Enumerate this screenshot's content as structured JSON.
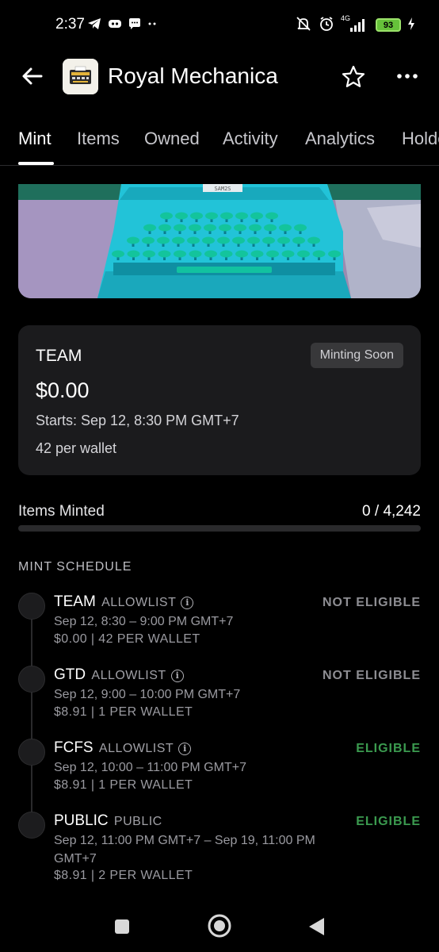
{
  "status_bar": {
    "time": "2:37",
    "network": "4G",
    "battery": "93"
  },
  "header": {
    "title": "Royal Mechanica"
  },
  "tabs": [
    {
      "label": "Mint",
      "active": true
    },
    {
      "label": "Items"
    },
    {
      "label": "Owned"
    },
    {
      "label": "Activity"
    },
    {
      "label": "Analytics"
    },
    {
      "label": "Holders"
    }
  ],
  "banner": {
    "sign_text": "SAM2S"
  },
  "current_phase": {
    "name": "TEAM",
    "badge": "Minting Soon",
    "price": "$0.00",
    "starts": "Starts: Sep 12, 8:30 PM GMT+7",
    "limit": "42 per wallet"
  },
  "minted": {
    "label": "Items Minted",
    "value": "0 / 4,242",
    "progress": 0
  },
  "schedule": {
    "title": "MINT SCHEDULE",
    "stages": [
      {
        "name": "TEAM",
        "type": "ALLOWLIST",
        "info": true,
        "time": "Sep 12, 8:30 – 9:00 PM GMT+7",
        "price": "$0.00 | 42 PER WALLET",
        "status": "NOT ELIGIBLE"
      },
      {
        "name": "GTD",
        "type": "ALLOWLIST",
        "info": true,
        "time": "Sep 12, 9:00 – 10:00 PM GMT+7",
        "price": "$8.91 | 1 PER WALLET",
        "status": "NOT ELIGIBLE"
      },
      {
        "name": "FCFS",
        "type": "ALLOWLIST",
        "info": true,
        "time": "Sep 12, 10:00 – 11:00 PM GMT+7",
        "price": "$8.91 | 1 PER WALLET",
        "status": "ELIGIBLE"
      },
      {
        "name": "PUBLIC",
        "type": "PUBLIC",
        "info": false,
        "time": "Sep 12, 11:00 PM GMT+7 – Sep 19, 11:00 PM GMT+7",
        "price": "$8.91 | 2 PER WALLET",
        "status": "ELIGIBLE"
      }
    ]
  },
  "colors": {
    "eligible": "#3b9a4f",
    "not_eligible": "#8e8e93",
    "card_bg": "#1b1b1d",
    "banner_cyan": "#22c3d8"
  }
}
